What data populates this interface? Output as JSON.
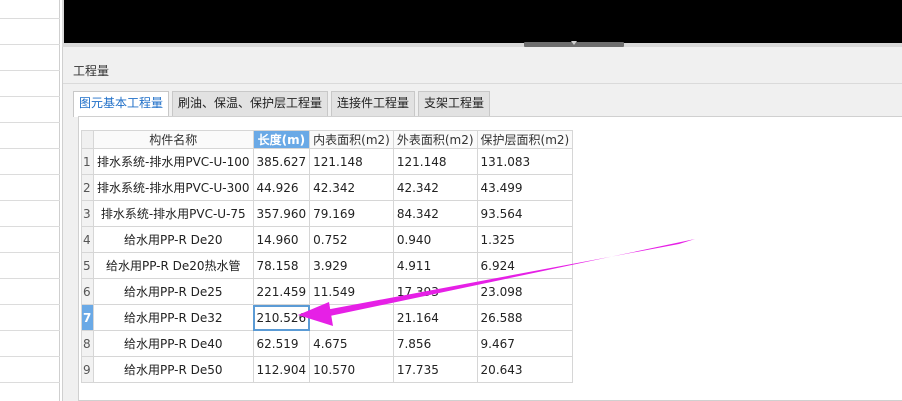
{
  "panel": {
    "title": "工程量",
    "tabs": [
      {
        "label": "图元基本工程量",
        "active": true
      },
      {
        "label": "刷油、保温、保护层工程量",
        "active": false
      },
      {
        "label": "连接件工程量",
        "active": false
      },
      {
        "label": "支架工程量",
        "active": false
      }
    ]
  },
  "table": {
    "columns": [
      "构件名称",
      "长度(m)",
      "内表面积(m2)",
      "外表面积(m2)",
      "保护层面积(m2)"
    ],
    "rows": [
      {
        "num": "1",
        "name": "排水系统-排水用PVC-U-100",
        "length": "385.627",
        "inner": "121.148",
        "outer": "121.148",
        "protect": "131.083"
      },
      {
        "num": "2",
        "name": "排水系统-排水用PVC-U-300",
        "length": "44.926",
        "inner": "42.342",
        "outer": "42.342",
        "protect": "43.499"
      },
      {
        "num": "3",
        "name": "排水系统-排水用PVC-U-75",
        "length": "357.960",
        "inner": "79.169",
        "outer": "84.342",
        "protect": "93.564"
      },
      {
        "num": "4",
        "name": "给水用PP-R De20",
        "length": "14.960",
        "inner": "0.752",
        "outer": "0.940",
        "protect": "1.325"
      },
      {
        "num": "5",
        "name": "给水用PP-R De20热水管",
        "length": "78.158",
        "inner": "3.929",
        "outer": "4.911",
        "protect": "6.924"
      },
      {
        "num": "6",
        "name": "给水用PP-R De25",
        "length": "221.459",
        "inner": "11.549",
        "outer": "17.393",
        "protect": "23.098"
      },
      {
        "num": "7",
        "name": "给水用PP-R De32",
        "length": "210.526",
        "inner": "",
        "outer": "21.164",
        "protect": "26.588"
      },
      {
        "num": "8",
        "name": "给水用PP-R De40",
        "length": "62.519",
        "inner": "4.675",
        "outer": "7.856",
        "protect": "9.467"
      },
      {
        "num": "9",
        "name": "给水用PP-R De50",
        "length": "112.904",
        "inner": "10.570",
        "outer": "17.735",
        "protect": "20.643"
      }
    ],
    "selected_row": "7",
    "selected_column": "长度(m)"
  },
  "colors": {
    "selection": "#6aa9e6",
    "active_tab_text": "#1f6fc8",
    "annotation_arrow": "#e620e6"
  }
}
